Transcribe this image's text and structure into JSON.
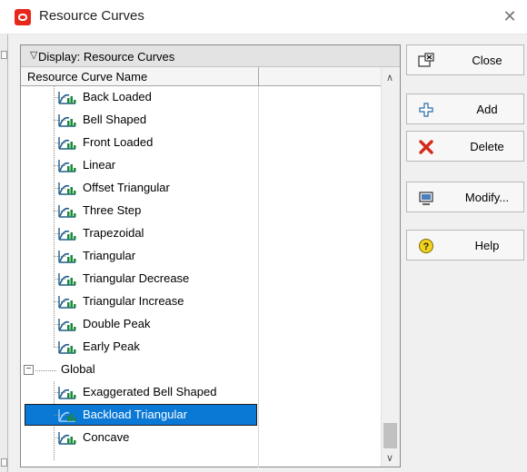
{
  "window": {
    "title": "Resource Curves",
    "icons": {
      "app": "oracle-app-icon",
      "close": "close-icon"
    }
  },
  "panel": {
    "header": "Display: Resource Curves",
    "column_header": "Resource Curve Name"
  },
  "tree": {
    "items": [
      {
        "label": "Back Loaded"
      },
      {
        "label": "Bell Shaped"
      },
      {
        "label": "Front Loaded"
      },
      {
        "label": "Linear"
      },
      {
        "label": "Offset Triangular"
      },
      {
        "label": "Three Step"
      },
      {
        "label": "Trapezoidal"
      },
      {
        "label": "Triangular"
      },
      {
        "label": "Triangular Decrease"
      },
      {
        "label": "Triangular Increase"
      },
      {
        "label": "Double Peak"
      },
      {
        "label": "Early Peak"
      }
    ],
    "group": {
      "label": "Global",
      "expander": "−",
      "items": [
        {
          "label": "Exaggerated Bell Shaped"
        },
        {
          "label": "Backload Triangular",
          "selected": true
        },
        {
          "label": "Concave"
        }
      ]
    }
  },
  "buttons": {
    "close": "Close",
    "add": "Add",
    "delete": "Delete",
    "modify": "Modify...",
    "help": "Help"
  },
  "colors": {
    "selection": "#0a79d6",
    "app_icon": "#e8271b",
    "delete_icon": "#d42a1a",
    "help_icon": "#f2d21c"
  }
}
